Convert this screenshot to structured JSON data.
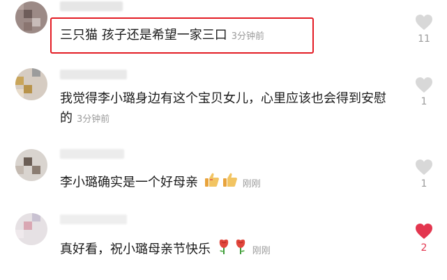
{
  "comments": [
    {
      "text": "三只猫  孩子还是希望一家三口",
      "time": "3分钟前",
      "likes": "11",
      "liked": false
    },
    {
      "text": "我觉得李小璐身边有这个宝贝女儿，心里应该也会得到安慰的",
      "time": "3分钟前",
      "likes": "1",
      "liked": false
    },
    {
      "text": "李小璐确实是一个好母亲",
      "emoji": [
        "thumbs-up",
        "thumbs-up"
      ],
      "time": "刚刚",
      "likes": "1",
      "liked": false
    },
    {
      "text": "真好看，祝小璐母亲节快乐",
      "emoji": [
        "rose",
        "rose"
      ],
      "time": "刚刚",
      "likes": "2",
      "liked": true
    }
  ],
  "colors": {
    "highlight_border": "#e31b23",
    "liked_heart": "#e3364f",
    "unliked_heart": "#d8d8d8",
    "time_text": "#9b9b9b"
  }
}
